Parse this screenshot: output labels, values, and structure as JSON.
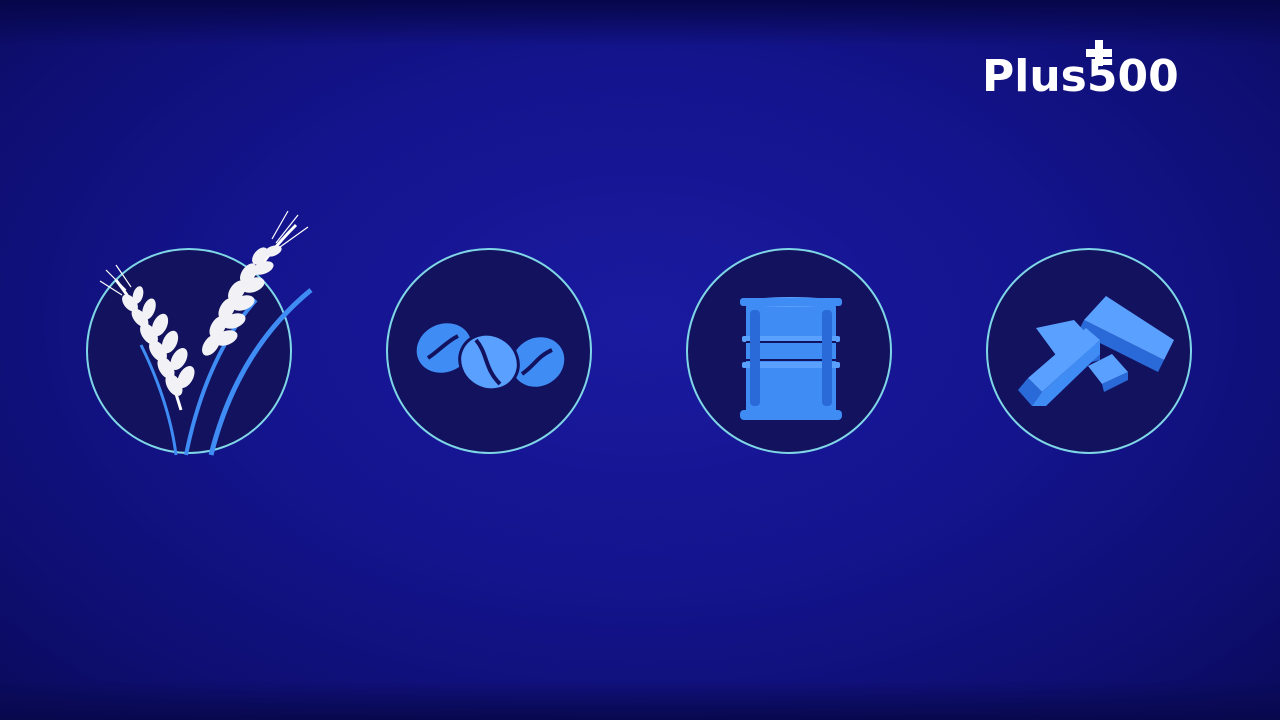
{
  "brand": {
    "logo_text": "Plus500",
    "color": "#ffffff"
  },
  "background_color": "#14148e",
  "accent_color": "#3f8cf5",
  "ring_color": "#7fd6e6",
  "icons": [
    {
      "name": "wheat-icon",
      "color": "#ffffff"
    },
    {
      "name": "coffee-beans-icon",
      "color": "#3f8cf5"
    },
    {
      "name": "oil-barrel-icon",
      "color": "#3f8cf5"
    },
    {
      "name": "gold-bars-icon",
      "color": "#3f8cf5"
    }
  ]
}
